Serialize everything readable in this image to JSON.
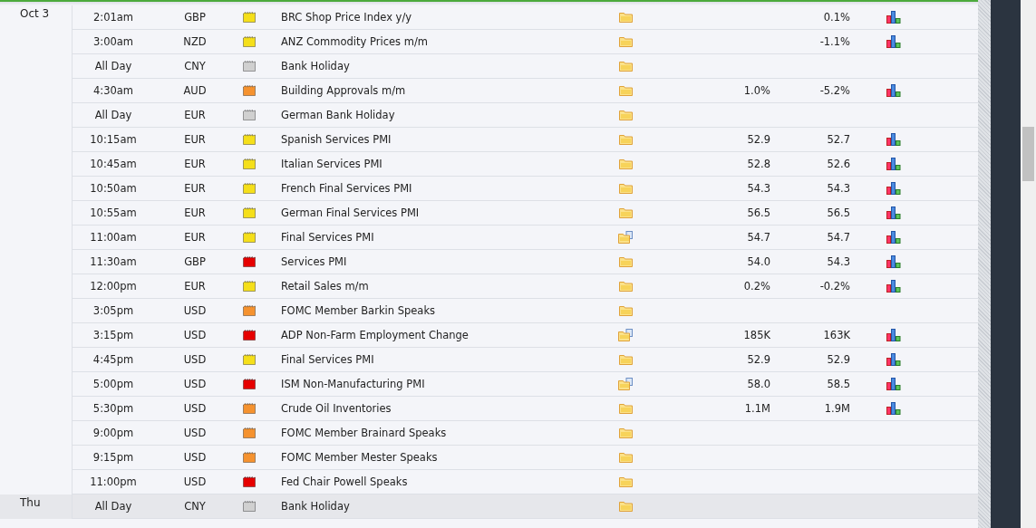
{
  "days": [
    {
      "date": "Oct 3",
      "selected": false,
      "events": [
        {
          "time": "2:01am",
          "currency": "GBP",
          "color": "#f5df1a",
          "event": "BRC Shop Price Index y/y",
          "has_document": false,
          "previous": "0.1%",
          "graph": true
        },
        {
          "time": "3:00am",
          "currency": "NZD",
          "color": "#f5df1a",
          "event": "ANZ Commodity Prices m/m",
          "has_document": false,
          "previous": "-1.1%",
          "graph": true
        },
        {
          "time": "All Day",
          "currency": "CNY",
          "color": "#d0d0d0",
          "event": "Bank Holiday",
          "has_document": false,
          "graph": false
        },
        {
          "time": "4:30am",
          "currency": "AUD",
          "color": "#f5922f",
          "event": "Building Approvals m/m",
          "has_document": false,
          "forecast": "1.0%",
          "previous": "-5.2%",
          "graph": true
        },
        {
          "time": "All Day",
          "currency": "EUR",
          "color": "#d0d0d0",
          "event": "German Bank Holiday",
          "has_document": false,
          "graph": false
        },
        {
          "time": "10:15am",
          "currency": "EUR",
          "color": "#f5df1a",
          "event": "Spanish Services PMI",
          "has_document": false,
          "forecast": "52.9",
          "previous": "52.7",
          "graph": true
        },
        {
          "time": "10:45am",
          "currency": "EUR",
          "color": "#f5df1a",
          "event": "Italian Services PMI",
          "has_document": false,
          "forecast": "52.8",
          "previous": "52.6",
          "graph": true
        },
        {
          "time": "10:50am",
          "currency": "EUR",
          "color": "#f5df1a",
          "event": "French Final Services PMI",
          "has_document": false,
          "forecast": "54.3",
          "previous": "54.3",
          "graph": true
        },
        {
          "time": "10:55am",
          "currency": "EUR",
          "color": "#f5df1a",
          "event": "German Final Services PMI",
          "has_document": false,
          "forecast": "56.5",
          "previous": "56.5",
          "graph": true
        },
        {
          "time": "11:00am",
          "currency": "EUR",
          "color": "#f5df1a",
          "event": "Final Services PMI",
          "has_document": true,
          "forecast": "54.7",
          "previous": "54.7",
          "graph": true
        },
        {
          "time": "11:30am",
          "currency": "GBP",
          "color": "#e60000",
          "event": "Services PMI",
          "has_document": false,
          "forecast": "54.0",
          "previous": "54.3",
          "graph": true
        },
        {
          "time": "12:00pm",
          "currency": "EUR",
          "color": "#f5df1a",
          "event": "Retail Sales m/m",
          "has_document": false,
          "forecast": "0.2%",
          "previous": "-0.2%",
          "graph": true
        },
        {
          "time": "3:05pm",
          "currency": "USD",
          "color": "#f5922f",
          "event": "FOMC Member Barkin Speaks",
          "has_document": false,
          "graph": false
        },
        {
          "time": "3:15pm",
          "currency": "USD",
          "color": "#e60000",
          "event": "ADP Non-Farm Employment Change",
          "has_document": true,
          "forecast": "185K",
          "previous": "163K",
          "graph": true
        },
        {
          "time": "4:45pm",
          "currency": "USD",
          "color": "#f5df1a",
          "event": "Final Services PMI",
          "has_document": false,
          "forecast": "52.9",
          "previous": "52.9",
          "graph": true
        },
        {
          "time": "5:00pm",
          "currency": "USD",
          "color": "#e60000",
          "event": "ISM Non-Manufacturing PMI",
          "has_document": true,
          "forecast": "58.0",
          "previous": "58.5",
          "graph": true
        },
        {
          "time": "5:30pm",
          "currency": "USD",
          "color": "#f5922f",
          "event": "Crude Oil Inventories",
          "has_document": false,
          "forecast": "1.1M",
          "previous": "1.9M",
          "graph": true
        },
        {
          "time": "9:00pm",
          "currency": "USD",
          "color": "#f5922f",
          "event": "FOMC Member Brainard Speaks",
          "has_document": false,
          "graph": false
        },
        {
          "time": "9:15pm",
          "currency": "USD",
          "color": "#f5922f",
          "event": "FOMC Member Mester Speaks",
          "has_document": false,
          "graph": false
        },
        {
          "time": "11:00pm",
          "currency": "USD",
          "color": "#e60000",
          "event": "Fed Chair Powell Speaks",
          "has_document": false,
          "graph": false
        }
      ]
    },
    {
      "date": "Thu",
      "selected": true,
      "events": [
        {
          "time": "All Day",
          "currency": "CNY",
          "color": "#d0d0d0",
          "event": "Bank Holiday",
          "has_document": false,
          "graph": false
        }
      ]
    }
  ]
}
